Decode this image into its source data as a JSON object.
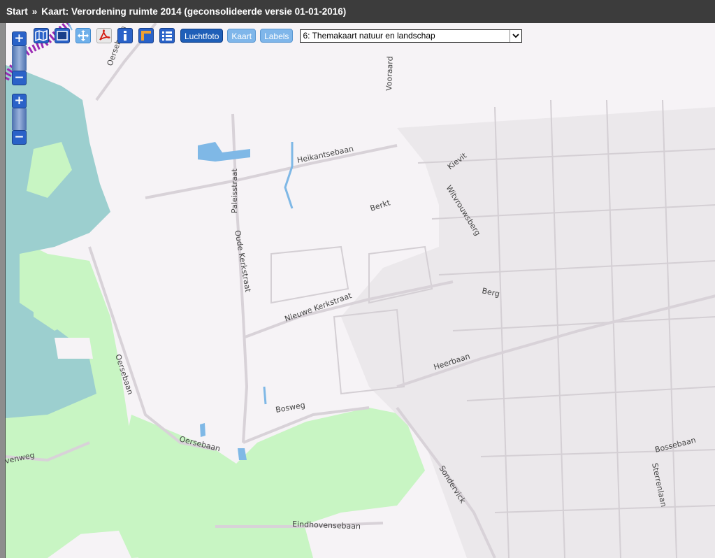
{
  "header": {
    "start_label": "Start",
    "separator": "»",
    "page_title": "Kaart: Verordening ruimte 2014 (geconsolideerde versie 01-01-2016)"
  },
  "toolbar": {
    "tools": [
      {
        "name": "map-overview-icon"
      },
      {
        "name": "zoom-box-icon"
      },
      {
        "name": "pan-icon"
      },
      {
        "name": "pdf-icon"
      },
      {
        "name": "info-icon"
      },
      {
        "name": "measure-icon"
      },
      {
        "name": "legend-list-icon"
      }
    ],
    "layers": [
      {
        "label": "Luchtfoto",
        "active": true
      },
      {
        "label": "Kaart",
        "active": false
      },
      {
        "label": "Labels",
        "active": false
      }
    ],
    "theme_select": {
      "value": "6: Themakaart natuur en landschap"
    }
  },
  "zoom": {
    "plus": "+",
    "minus": "−"
  },
  "map": {
    "street_labels": [
      "Oersebaan",
      "Vooraard",
      "Heikantsebaan",
      "Kievit",
      "Witvrouwsberg",
      "Berkt",
      "Paleisstraat",
      "Oude Kerkstraat",
      "Nieuwe Kerkstraat",
      "Berg",
      "Heerbaan",
      "Oersebaan",
      "Bosweg",
      "Oersebaan",
      "venweg",
      "Sondervick",
      "Bossebaan",
      "Sterrenlaan",
      "Eindhovensebaan"
    ]
  },
  "colors": {
    "title_bar": "#3c3c3c",
    "map_background": "#f6f3f6",
    "nature_green": "#c8f5c3",
    "teal_zone": "#9ccfcf",
    "water": "#7fb8e6",
    "accent_blue": "#1f5fb8"
  }
}
